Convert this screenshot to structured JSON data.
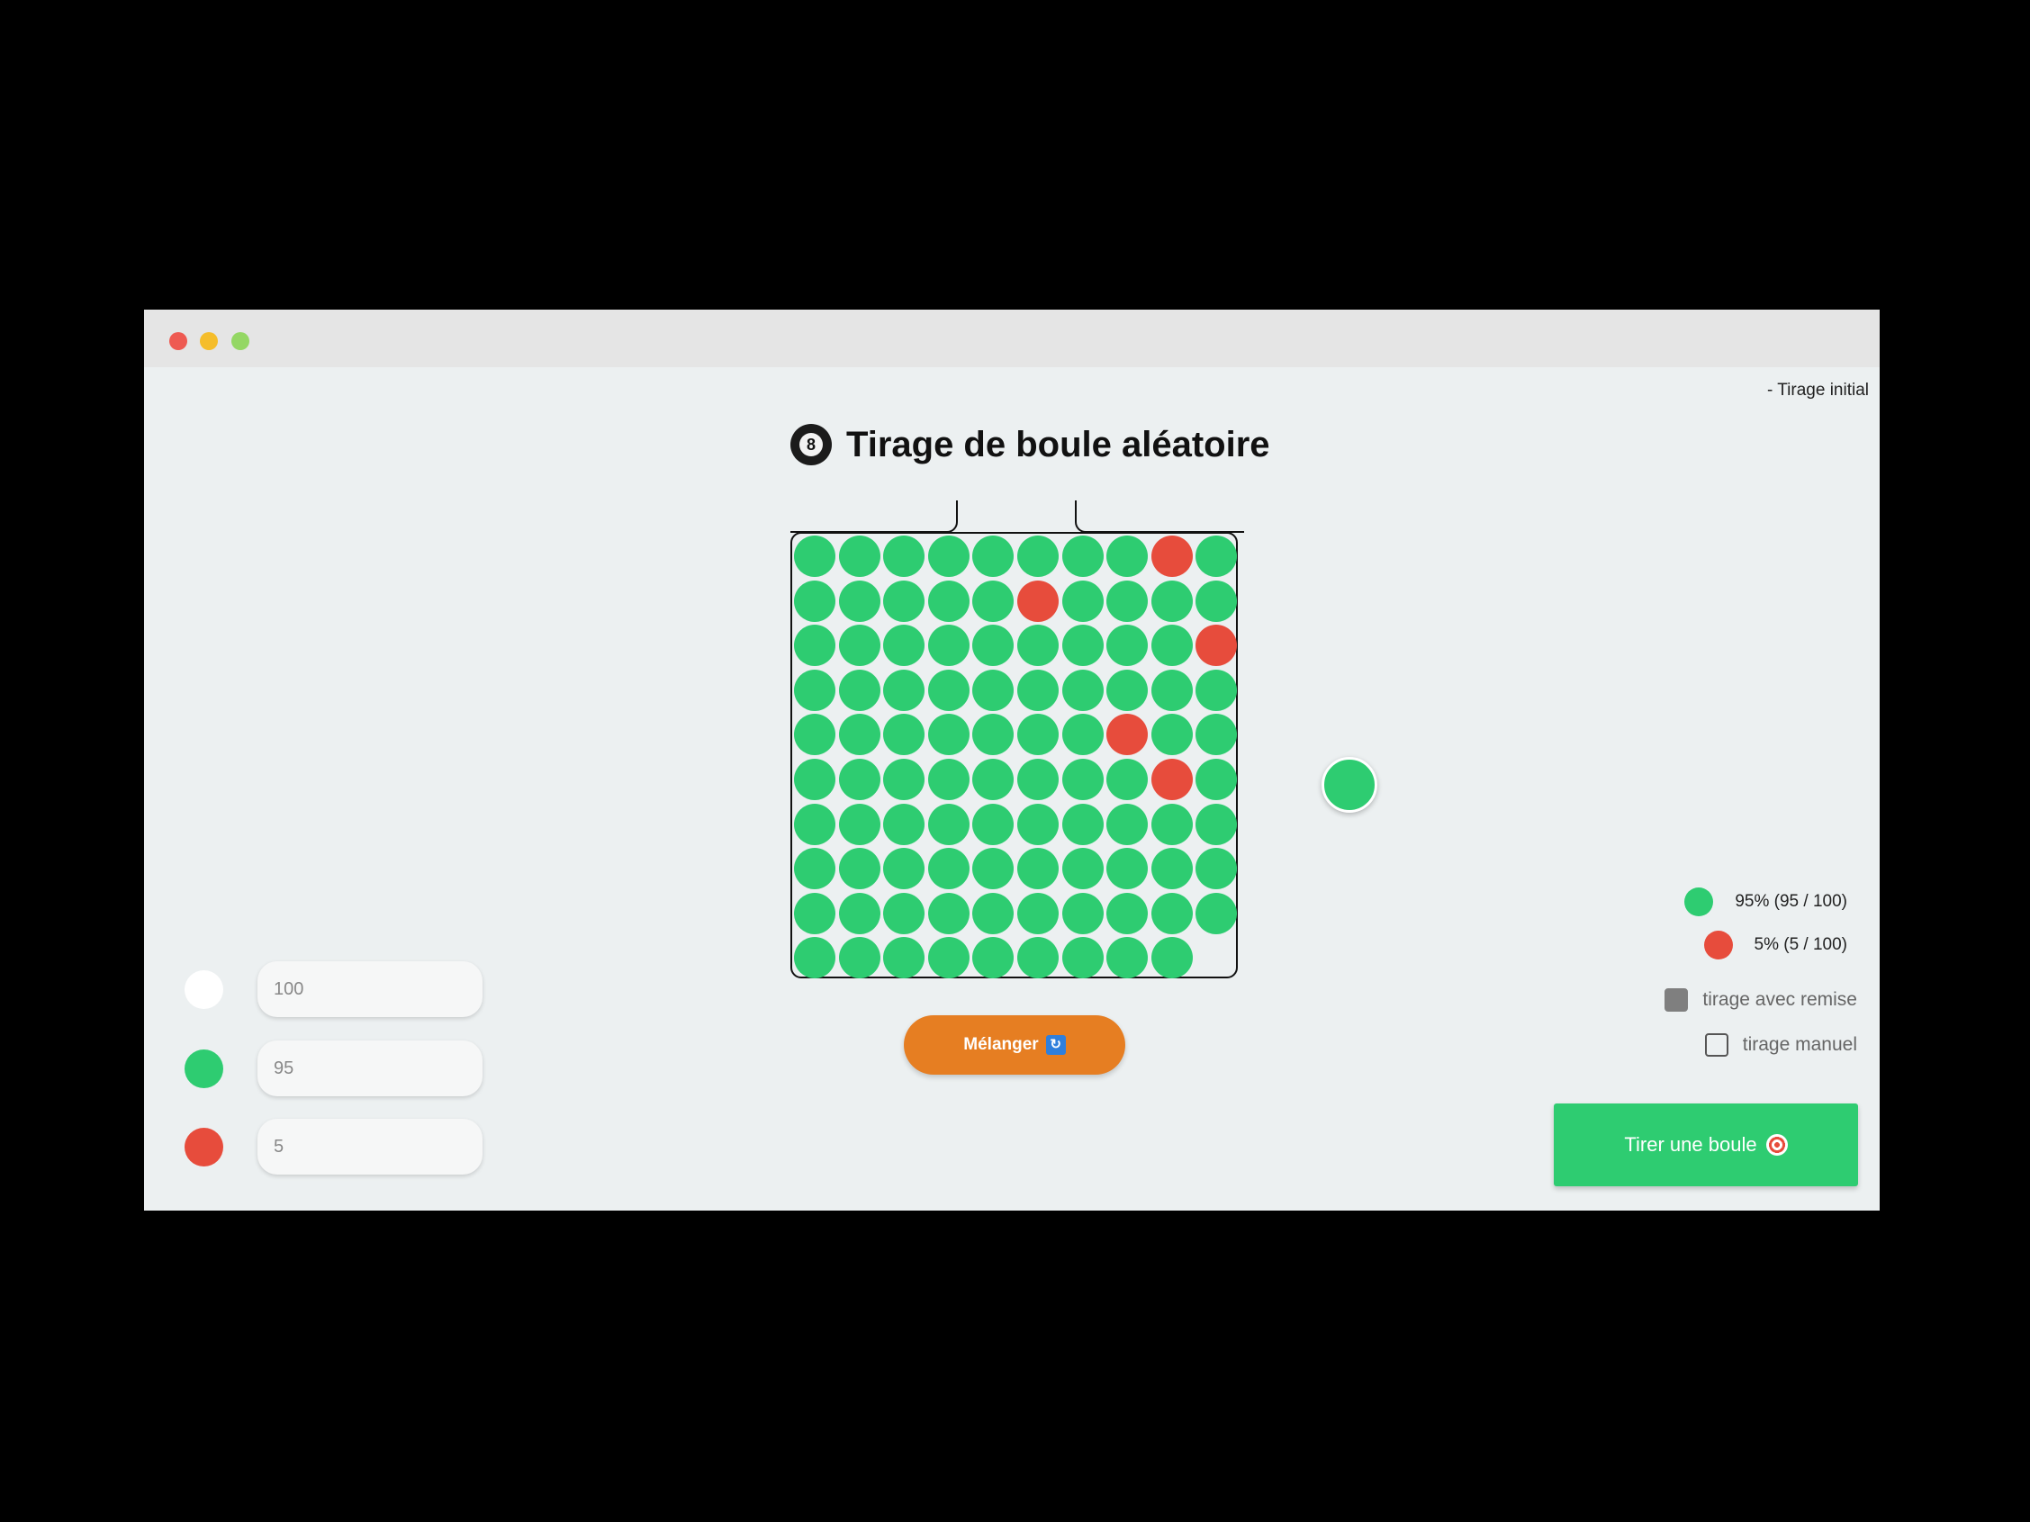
{
  "window": {
    "controls": [
      "close",
      "minimize",
      "maximize"
    ]
  },
  "history": {
    "label": "- Tirage initial"
  },
  "header": {
    "icon": "8-ball-icon",
    "title": "Tirage de boule aléatoire"
  },
  "colors": {
    "green": "#2ecc71",
    "red": "#e74c3c",
    "white": "#ffffff",
    "orange": "#e67e22"
  },
  "urn": {
    "total": 100,
    "columns": 10,
    "balls": [
      "g",
      "g",
      "g",
      "g",
      "g",
      "g",
      "g",
      "g",
      "r",
      "g",
      "g",
      "g",
      "g",
      "g",
      "g",
      "r",
      "g",
      "g",
      "g",
      "g",
      "g",
      "g",
      "g",
      "g",
      "g",
      "g",
      "g",
      "g",
      "g",
      "r",
      "g",
      "g",
      "g",
      "g",
      "g",
      "g",
      "g",
      "g",
      "g",
      "g",
      "g",
      "g",
      "g",
      "g",
      "g",
      "g",
      "g",
      "r",
      "g",
      "g",
      "g",
      "g",
      "g",
      "g",
      "g",
      "g",
      "g",
      "g",
      "r",
      "g",
      "g",
      "g",
      "g",
      "g",
      "g",
      "g",
      "g",
      "g",
      "g",
      "g",
      "g",
      "g",
      "g",
      "g",
      "g",
      "g",
      "g",
      "g",
      "g",
      "g",
      "g",
      "g",
      "g",
      "g",
      "g",
      "g",
      "g",
      "g",
      "g",
      "g",
      "g",
      "g",
      "g",
      "g",
      "g",
      "g",
      "g",
      "g",
      "g"
    ]
  },
  "shuffle": {
    "label": "Mélanger",
    "icon": "shuffle-icon"
  },
  "drawn": {
    "color": "green"
  },
  "stats": [
    {
      "color": "green",
      "text": "95% (95 / 100)"
    },
    {
      "color": "red",
      "text": "5% (5 / 100)"
    }
  ],
  "options": [
    {
      "label": "tirage avec remise",
      "checked": true
    },
    {
      "label": "tirage manuel",
      "checked": false
    }
  ],
  "draw_button": {
    "label": "Tirer une boule",
    "icon": "target-icon"
  },
  "inputs": [
    {
      "color": "white",
      "value": "",
      "placeholder": "100"
    },
    {
      "color": "green",
      "value": "95",
      "placeholder": ""
    },
    {
      "color": "red",
      "value": "5",
      "placeholder": ""
    }
  ]
}
